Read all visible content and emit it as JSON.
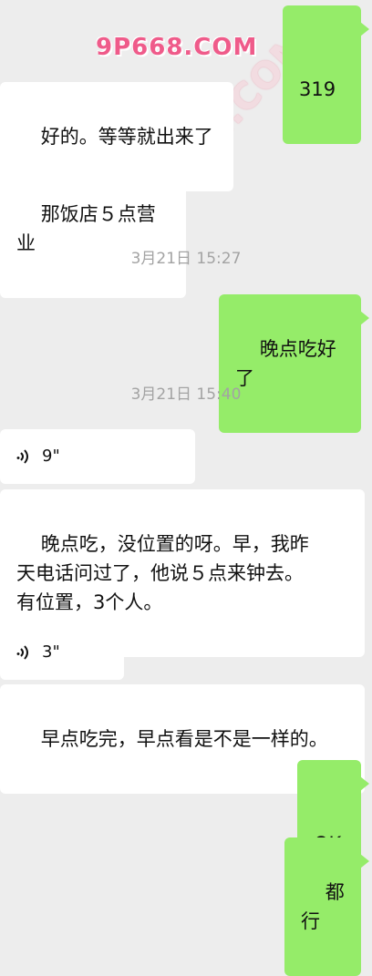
{
  "watermarks": [
    "9P668.COM",
    "91PORN.COM"
  ],
  "messages": [
    {
      "type": "text",
      "side": "out",
      "text": "319"
    },
    {
      "type": "text",
      "side": "in",
      "text": "好的。等等就出来了"
    },
    {
      "type": "text",
      "side": "in",
      "text": "那饭店５点营业"
    },
    {
      "type": "timestamp",
      "text": "3月21日 15:27"
    },
    {
      "type": "text",
      "side": "out",
      "text": "晚点吃好了"
    },
    {
      "type": "timestamp",
      "text": "3月21日 15:40"
    },
    {
      "type": "voice",
      "side": "in",
      "duration": "9\""
    },
    {
      "type": "text",
      "side": "in",
      "text": "晚点吃，没位置的呀。早，我昨\n天电话问过了，他说５点来钟去。\n有位置，3个人。"
    },
    {
      "type": "voice",
      "side": "in",
      "duration": "3\""
    },
    {
      "type": "text",
      "side": "in",
      "text": "早点吃完，早点看是不是一样的。"
    },
    {
      "type": "text",
      "side": "out",
      "text": "OK"
    },
    {
      "type": "text",
      "side": "out",
      "text": "都行"
    }
  ],
  "colors": {
    "background": "#ededed",
    "incoming_bubble": "#ffffff",
    "outgoing_bubble": "#95ec69",
    "timestamp_text": "#a3a3a3"
  },
  "icons": {
    "voice": "voice-wave-icon"
  }
}
